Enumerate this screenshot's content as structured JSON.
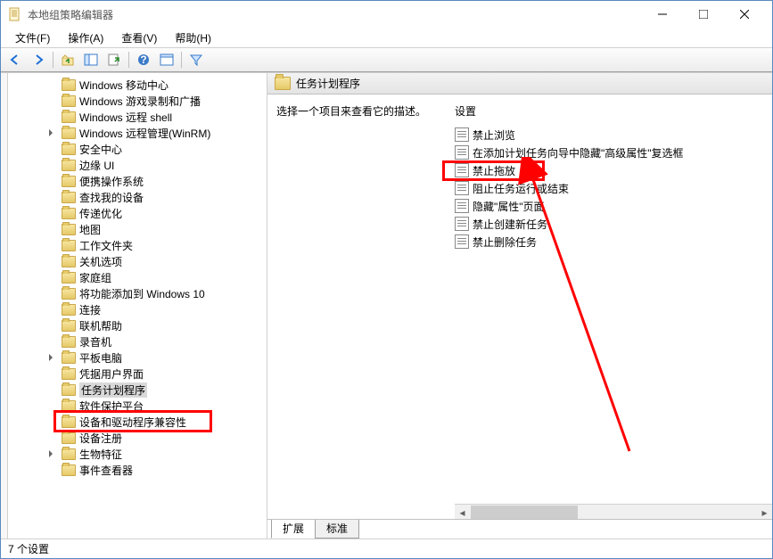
{
  "window": {
    "title": "本地组策略编辑器"
  },
  "menubar": {
    "file": "文件(F)",
    "action": "操作(A)",
    "view": "查看(V)",
    "help": "帮助(H)"
  },
  "tree": {
    "items": [
      {
        "label": "Windows 移动中心",
        "expander": false,
        "level": 1
      },
      {
        "label": "Windows 游戏录制和广播",
        "expander": false,
        "level": 1
      },
      {
        "label": "Windows 远程 shell",
        "expander": false,
        "level": 1
      },
      {
        "label": "Windows 远程管理(WinRM)",
        "expander": true,
        "level": 1
      },
      {
        "label": "安全中心",
        "expander": false,
        "level": 1
      },
      {
        "label": "边缘 UI",
        "expander": false,
        "level": 1
      },
      {
        "label": "便携操作系统",
        "expander": false,
        "level": 1
      },
      {
        "label": "查找我的设备",
        "expander": false,
        "level": 1
      },
      {
        "label": "传递优化",
        "expander": false,
        "level": 1
      },
      {
        "label": "地图",
        "expander": false,
        "level": 1
      },
      {
        "label": "工作文件夹",
        "expander": false,
        "level": 1
      },
      {
        "label": "关机选项",
        "expander": false,
        "level": 1
      },
      {
        "label": "家庭组",
        "expander": false,
        "level": 1
      },
      {
        "label": "将功能添加到 Windows 10",
        "expander": false,
        "level": 1
      },
      {
        "label": "连接",
        "expander": false,
        "level": 1
      },
      {
        "label": "联机帮助",
        "expander": false,
        "level": 1
      },
      {
        "label": "录音机",
        "expander": false,
        "level": 1
      },
      {
        "label": "平板电脑",
        "expander": true,
        "level": 1
      },
      {
        "label": "凭据用户界面",
        "expander": false,
        "level": 1
      },
      {
        "label": "任务计划程序",
        "expander": false,
        "level": 1,
        "selected": true
      },
      {
        "label": "软件保护平台",
        "expander": false,
        "level": 1
      },
      {
        "label": "设备和驱动程序兼容性",
        "expander": false,
        "level": 1
      },
      {
        "label": "设备注册",
        "expander": false,
        "level": 1
      },
      {
        "label": "生物特征",
        "expander": true,
        "level": 1
      },
      {
        "label": "事件查看器",
        "expander": false,
        "level": 1
      }
    ]
  },
  "right": {
    "header_title": "任务计划程序",
    "description_prompt": "选择一个项目来查看它的描述。",
    "settings_header": "设置",
    "settings": [
      "禁止浏览",
      "在添加计划任务向导中隐藏\"高级属性\"复选框",
      "禁止拖放",
      "阻止任务运行或结束",
      "隐藏\"属性\"页面",
      "禁止创建新任务",
      "禁止删除任务"
    ]
  },
  "tabs": {
    "extended": "扩展",
    "standard": "标准"
  },
  "statusbar": {
    "text": "7 个设置"
  }
}
